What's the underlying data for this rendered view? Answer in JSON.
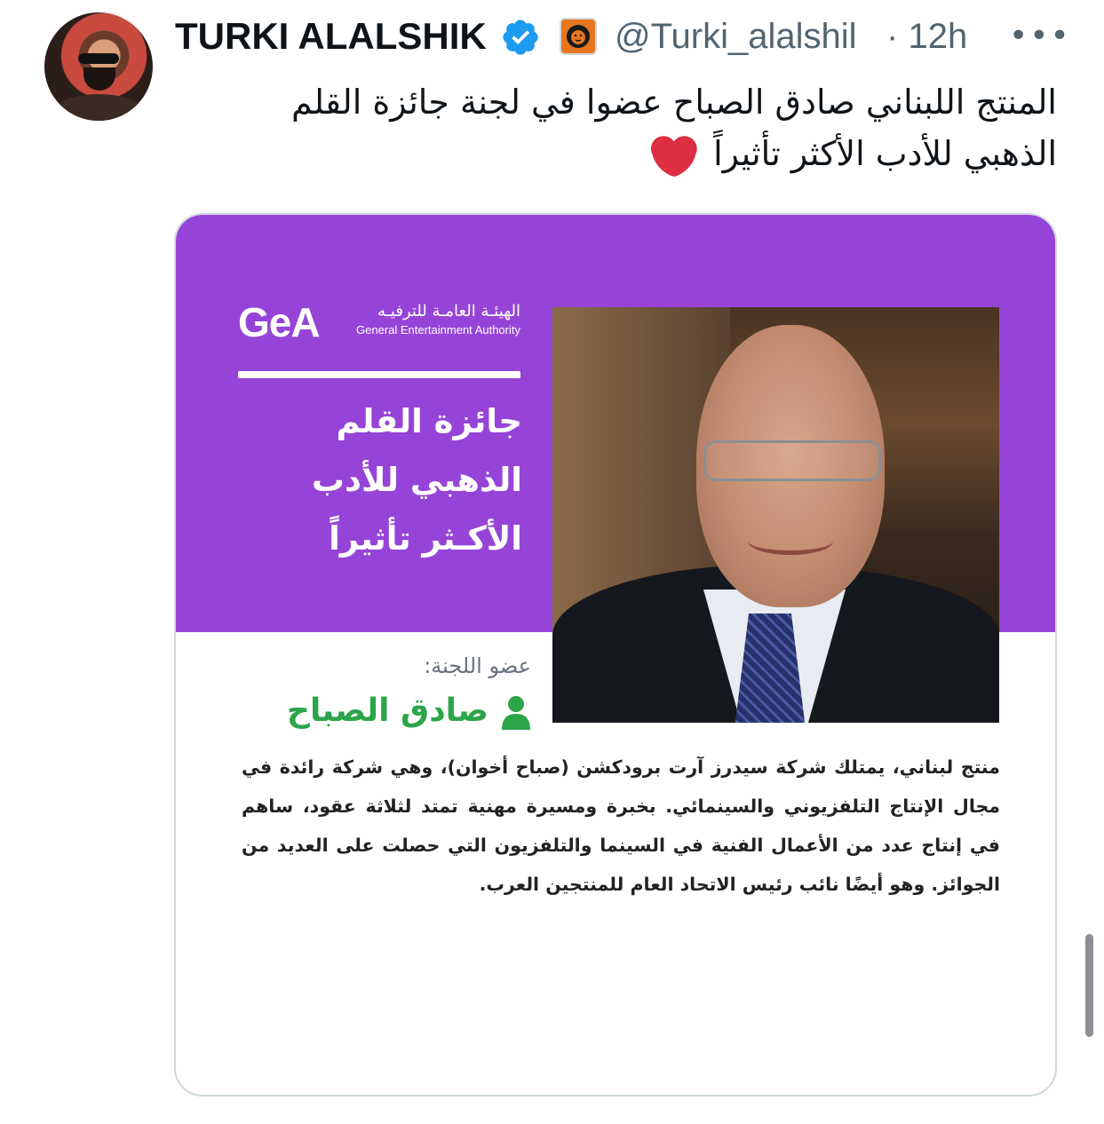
{
  "tweet": {
    "author_name": "TURKI ALALSHIK",
    "handle": "@Turki_alalshil",
    "separator": "·",
    "time": "12h",
    "more": "•••",
    "text": "المنتج اللبناني صادق الصباح عضوا في لجنة جائزة القلم الذهبي للأدب الأكثر تأثيراً"
  },
  "card": {
    "logo_letters": "GeA",
    "logo_arabic": "الهيئـة العامـة للترفيـه",
    "logo_english": "General Entertainment Authority",
    "award_title": "جائزة القلم الذهبي للأدب الأكـثر تأثيراً",
    "member_label": "عضو اللجنة:",
    "member_name": "صادق الصباح",
    "bio": "منتج لبناني، يمتلك شركة سيدرز آرت برودكشن (صباح أخوان)، وهي شركة رائدة في مجال الإنتاج التلفزيوني والسينمائي. بخبرة ومسيرة مهنية تمتد لثلاثة عقود، ساهم في إنتاج عدد من الأعمال الفنية في السينما والتلفزيون التي حصلت على العديد من الجوائز. وهو أيضًا نائب رئيس الاتحاد العام للمنتجين العرب."
  },
  "colors": {
    "card_purple": "#9644d8",
    "member_green": "#2ca54a",
    "verified_blue": "#1d9bf0",
    "heart_red": "#dd2e44",
    "muted_text": "#536471"
  },
  "icons": {
    "verified": "verified-badge-icon",
    "affiliate": "lion-affiliate-icon",
    "heart": "red-heart-icon",
    "person": "person-icon"
  }
}
